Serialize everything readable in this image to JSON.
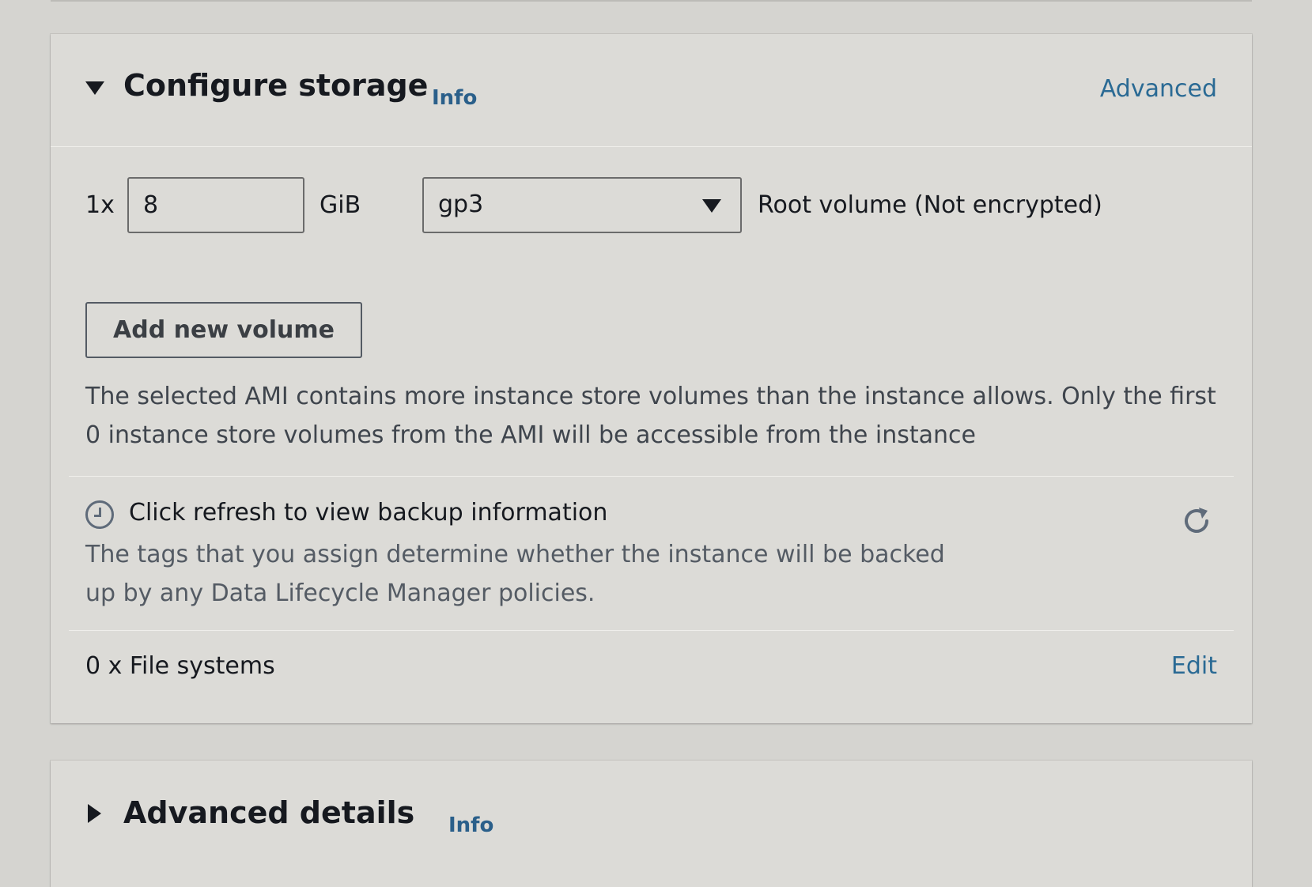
{
  "storage": {
    "title": "Configure storage",
    "info_label": "Info",
    "advanced_label": "Advanced",
    "volume": {
      "count_label": "1x",
      "size_value": "8",
      "unit_label": "GiB",
      "type_value": "gp3",
      "root_label": "Root volume",
      "encryption_label": "(Not encrypted)"
    },
    "add_volume_label": "Add new volume",
    "warning_text": "The selected AMI contains more instance store volumes than the instance allows. Only the first 0 instance store volumes from the AMI will be accessible from the instance",
    "backup": {
      "title": "Click refresh to view backup information",
      "description": "The tags that you assign determine whether the instance will be backed up by any Data Lifecycle Manager policies."
    },
    "file_systems_label": "0 x File systems",
    "edit_label": "Edit"
  },
  "advanced_details": {
    "title": "Advanced details",
    "info_label": "Info"
  },
  "colors": {
    "link": "#2a6a94",
    "background": "#d5d4d0",
    "panel": "#dcdbd7"
  }
}
